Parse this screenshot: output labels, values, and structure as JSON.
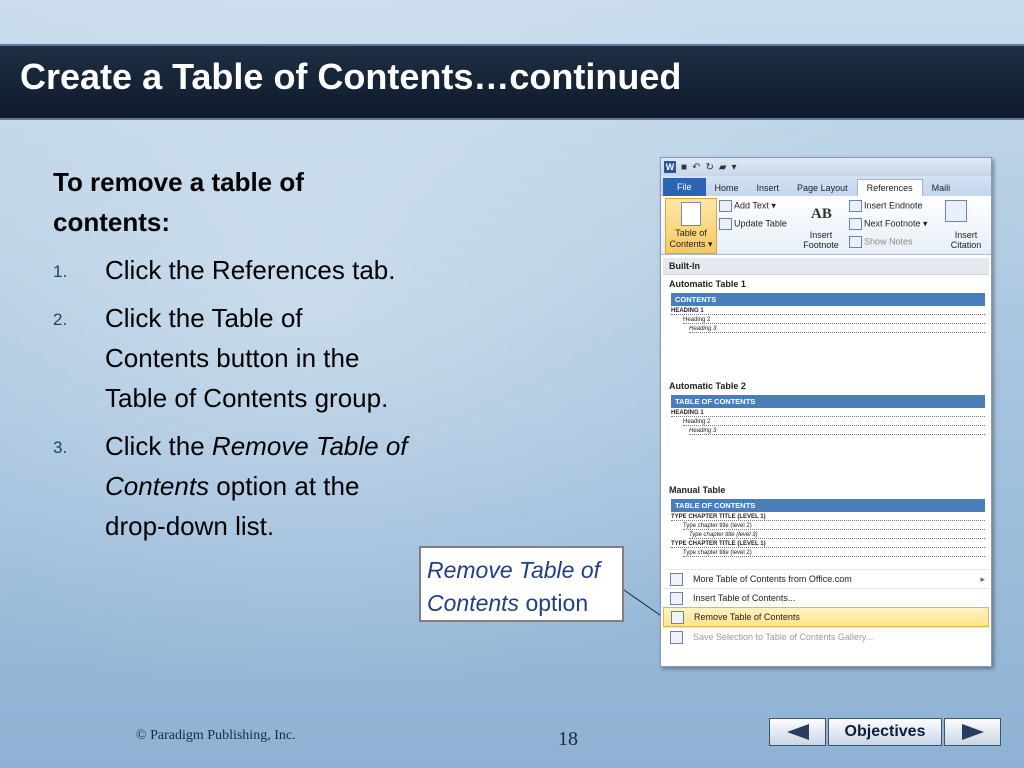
{
  "slide": {
    "title": "Create a Table of Contents…continued",
    "intro": "To remove a table of contents:",
    "steps": [
      {
        "num": "1.",
        "text": "Click the References tab."
      },
      {
        "num": "2.",
        "text": "Click the Table of Contents button in the Table of Contents group."
      },
      {
        "num": "3.",
        "pre": "Click the ",
        "em": "Remove Table of Contents",
        "post": " option at the drop-down list."
      }
    ],
    "callout": {
      "em": "Remove Table of",
      "em2": "Contents",
      "post": " option"
    }
  },
  "word": {
    "logo": "W",
    "tabs": [
      "File",
      "Home",
      "Insert",
      "Page Layout",
      "References",
      "Maili"
    ],
    "active_tab": "References",
    "ribbon": {
      "toc_button": "Table of Contents",
      "add_text": "Add Text",
      "update_table": "Update Table",
      "ab_glyph": "AB",
      "insert_footnote": "Insert Footnote",
      "insert_endnote": "Insert Endnote",
      "next_footnote": "Next Footnote",
      "show_notes": "Show Notes",
      "insert_citation": "Insert Citation"
    },
    "dropdown": {
      "section": "Built-In",
      "auto1": {
        "label": "Automatic Table 1",
        "header": "CONTENTS",
        "lines": [
          "HEADING 1",
          "Heading 2",
          "Heading 3"
        ]
      },
      "auto2": {
        "label": "Automatic Table 2",
        "header": "TABLE OF CONTENTS",
        "lines": [
          "HEADING 1",
          "Heading 2",
          "Heading 3"
        ]
      },
      "manual": {
        "label": "Manual Table",
        "header": "TABLE OF CONTENTS",
        "lines": [
          "TYPE CHAPTER TITLE (LEVEL 1)",
          "Type chapter title (level 2)",
          "Type chapter title (level 3)",
          "TYPE CHAPTER TITLE (LEVEL 1)",
          "Type chapter title (level 2)"
        ]
      },
      "menu": {
        "more": "More Table of Contents from Office.com",
        "insert": "Insert Table of Contents...",
        "remove": "Remove Table of Contents",
        "save": "Save Selection to Table of Contents Gallery..."
      }
    }
  },
  "footer": {
    "copyright": "© Paradigm Publishing, Inc.",
    "page": "18",
    "objectives": "Objectives"
  }
}
